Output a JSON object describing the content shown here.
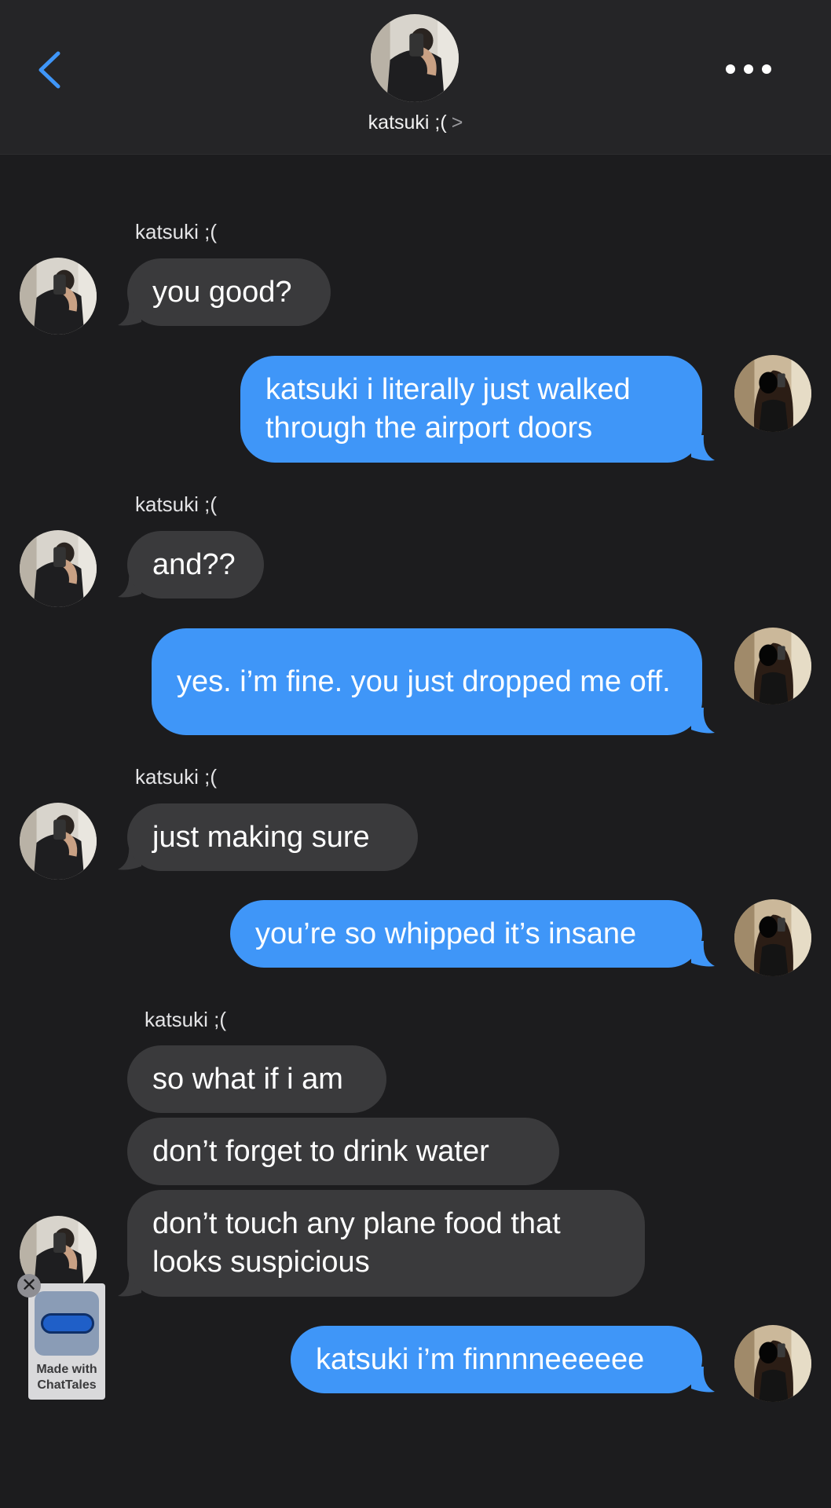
{
  "header": {
    "contact_name": "katsuki ;(",
    "chevron": ">"
  },
  "sender_name": "katsuki ;(",
  "messages": [
    {
      "from": "them",
      "text": "you good?"
    },
    {
      "from": "me",
      "text": "katsuki i literally just walked through the airport doors"
    },
    {
      "from": "them",
      "text": "and??"
    },
    {
      "from": "me",
      "text": "yes. i’m fine. you just dropped me off."
    },
    {
      "from": "them",
      "text": "just making sure"
    },
    {
      "from": "me",
      "text": "you’re so whipped it’s insane"
    },
    {
      "from": "them",
      "text": "so what if i am"
    },
    {
      "from": "them",
      "text": "don’t forget to drink water"
    },
    {
      "from": "them",
      "text": "don’t touch any plane food that looks suspicious"
    },
    {
      "from": "me",
      "text": "katsuki i’m finnnneeeeee"
    }
  ],
  "watermark": {
    "line1": "Made with",
    "line2": "ChatTales",
    "close": "✕"
  },
  "colors": {
    "background": "#1c1c1e",
    "incoming_bubble": "#3a3a3c",
    "outgoing_bubble": "#3f96f8",
    "accent": "#3f96f8"
  },
  "icons": [
    "back-chevron-icon",
    "more-options-icon",
    "close-icon",
    "chat-bubble-icon"
  ]
}
